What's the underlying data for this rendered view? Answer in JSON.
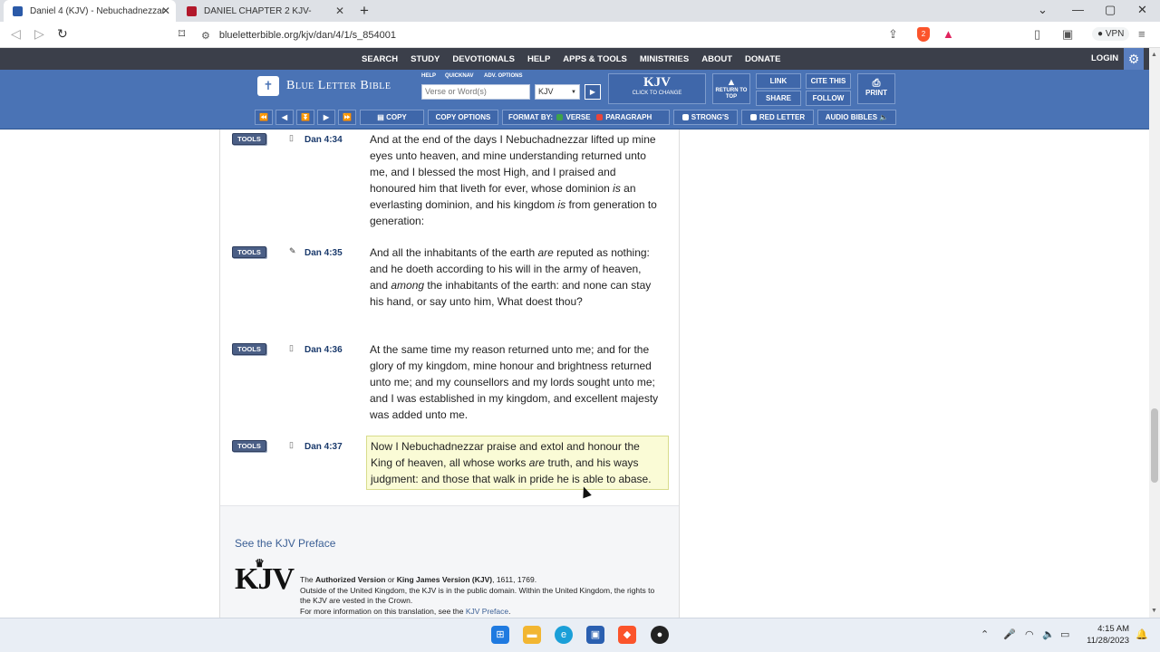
{
  "browser": {
    "tabs": [
      {
        "title": "Daniel 4 (KJV) - Nebuchadnezzar",
        "active": true
      },
      {
        "title": "DANIEL CHAPTER 2 KJV-",
        "active": false
      }
    ],
    "url": "blueletterbible.org/kjv/dan/4/1/s_854001",
    "vpn_label": "VPN",
    "shield_badge": "2"
  },
  "site": {
    "topnav": [
      "SEARCH",
      "STUDY",
      "DEVOTIONALS",
      "HELP",
      "APPS & TOOLS",
      "MINISTRIES",
      "ABOUT",
      "DONATE"
    ],
    "login": "LOGIN",
    "logo_text": "Blue Letter Bible",
    "mini_links": [
      "HELP",
      "QUICKNAV",
      "ADV. OPTIONS"
    ],
    "search_placeholder": "Verse or Word(s)",
    "version_select": "KJV",
    "kjv_big": "KJV",
    "kjv_small": "CLICK TO CHANGE",
    "return_top": "RETURN TO TOP",
    "link": "LINK",
    "share": "SHARE",
    "cite": "CITE THIS",
    "follow": "FOLLOW",
    "print": "PRINT",
    "toolbar": {
      "copy": "COPY",
      "copy_options": "COPY OPTIONS",
      "format_by": "FORMAT BY:",
      "verse": "VERSE",
      "paragraph": "PARAGRAPH",
      "strongs": "STRONG'S",
      "red_letter": "RED LETTER",
      "audio": "AUDIO BIBLES"
    }
  },
  "verses": [
    {
      "tools": "TOOLS",
      "ref": "Dan 4:34",
      "text": "And at the end of the days I Nebuchadnezzar lifted up mine eyes unto heaven, and mine understanding returned unto me, and I blessed the most High, and I praised and honoured him that liveth for ever, whose dominion is an everlasting dominion, and his kingdom is from generation to generation:",
      "highlighted": false
    },
    {
      "tools": "TOOLS",
      "ref": "Dan 4:35",
      "text": "And all the inhabitants of the earth are reputed as nothing: and he doeth according to his will in the army of heaven, and among the inhabitants of the earth: and none can stay his hand, or say unto him, What doest thou?",
      "highlighted": false
    },
    {
      "tools": "TOOLS",
      "ref": "Dan 4:36",
      "text": "At the same time my reason returned unto me; and for the glory of my kingdom, mine honour and brightness returned unto me; and my counsellors and my lords sought unto me; and I was established in my kingdom, and excellent majesty was added unto me.",
      "highlighted": false
    },
    {
      "tools": "TOOLS",
      "ref": "Dan 4:37",
      "text": "Now I Nebuchadnezzar praise and extol and honour the King of heaven, all whose works are truth, and his ways judgment: and those that walk in pride he is able to abase.",
      "highlighted": true
    }
  ],
  "footer": {
    "preface_link": "See the KJV Preface",
    "logo": "KJV",
    "line1_pre": "The ",
    "line1_b1": "Authorized Version",
    "line1_mid": " or ",
    "line1_b2": "King James Version (KJV)",
    "line1_post": ", 1611, 1769.",
    "line2": "Outside of the United Kingdom, the KJV is in the public domain. Within the United Kingdom, the rights to the KJV are vested in the Crown.",
    "line3_pre": "For more information on this translation, see the ",
    "line3_link": "KJV Preface",
    "line3_post": "."
  },
  "taskbar": {
    "time": "4:15 AM",
    "date": "11/28/2023"
  }
}
